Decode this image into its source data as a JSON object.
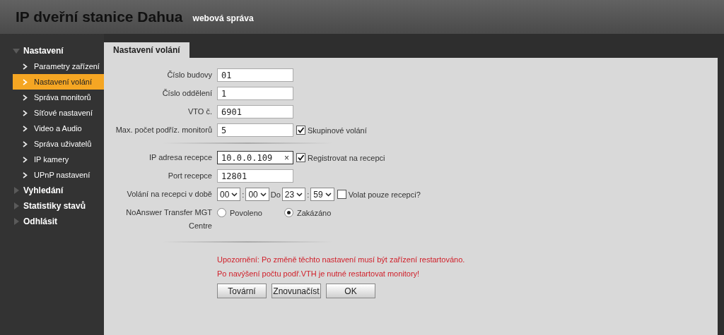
{
  "header": {
    "title": "IP dveřní stanice Dahua",
    "subtitle": "webová správa"
  },
  "sidebar": {
    "items": [
      {
        "label": "Nastavení",
        "expanded": true,
        "selected": false,
        "children": [
          {
            "label": "Parametry zařízení",
            "selected": false
          },
          {
            "label": "Nastavení volání",
            "selected": true
          },
          {
            "label": "Správa monitorů",
            "selected": false
          },
          {
            "label": "Síťové nastavení",
            "selected": false
          },
          {
            "label": "Video a Audio",
            "selected": false
          },
          {
            "label": "Správa uživatelů",
            "selected": false
          },
          {
            "label": "IP kamery",
            "selected": false
          },
          {
            "label": "UPnP nastavení",
            "selected": false
          }
        ]
      },
      {
        "label": "Vyhledání",
        "expanded": false,
        "selected": false
      },
      {
        "label": "Statistiky stavů",
        "expanded": false,
        "selected": false
      },
      {
        "label": "Odhlásit",
        "expanded": false,
        "selected": false
      }
    ]
  },
  "tabs": [
    {
      "label": "Nastavení volání",
      "selected": true
    }
  ],
  "form": {
    "sections": [
      [
        {
          "kind": "text",
          "label": "Číslo budovy",
          "value": "01",
          "focused": false
        },
        {
          "kind": "text",
          "label": "Číslo oddělení",
          "value": "1",
          "focused": false
        },
        {
          "kind": "text",
          "label": "VTO č.",
          "value": "6901",
          "focused": false
        },
        {
          "kind": "text",
          "label": "Max. počet podříz. monitorů",
          "value": "5",
          "focused": false,
          "checkbox": {
            "label": "Skupinové volání",
            "checked": true
          }
        }
      ],
      [
        {
          "kind": "text",
          "label": "IP adresa recepce",
          "value": "10.0.0.109",
          "focused": true,
          "clear": "×",
          "checkbox": {
            "label": "Registrovat na recepci",
            "checked": true
          }
        },
        {
          "kind": "text",
          "label": "Port recepce",
          "value": "12801",
          "focused": false
        },
        {
          "kind": "time",
          "label": "Volání na recepci v době",
          "parts": [
            {
              "kind": "select",
              "text": "00"
            },
            {
              "kind": "sep",
              "text": ":"
            },
            {
              "kind": "select",
              "text": "00"
            },
            {
              "kind": "sep",
              "text": "Do"
            },
            {
              "kind": "select",
              "text": "23"
            },
            {
              "kind": "sep",
              "text": ":"
            },
            {
              "kind": "select",
              "text": "59"
            }
          ],
          "checkbox": {
            "label": "Volat pouze recepci?",
            "checked": false
          }
        },
        {
          "kind": "radio",
          "label": "NoAnswer Transfer MGT Centre",
          "options": [
            {
              "label": "Povoleno",
              "selected": false
            },
            {
              "label": "Zakázáno",
              "selected": true
            }
          ]
        }
      ]
    ],
    "warnings": [
      "Upozornění: Po změně těchto nastavení musí být zařízení restartováno.",
      "Po navýšení počtu podř.VTH je nutné restartovat monitory!"
    ],
    "buttons": [
      "Tovární",
      "Znovunačíst",
      "OK"
    ]
  }
}
